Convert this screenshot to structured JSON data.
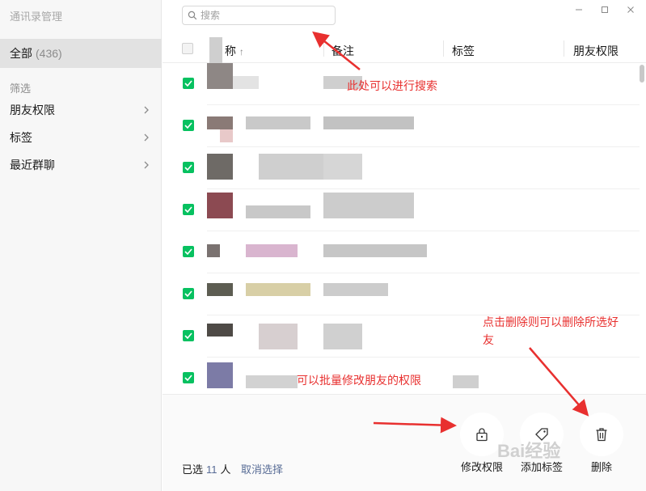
{
  "app": {
    "title": "通讯录管理"
  },
  "sidebar": {
    "all_label": "全部",
    "all_count": "(436)",
    "filter_section": "筛选",
    "filters": [
      {
        "label": "朋友权限"
      },
      {
        "label": "标签"
      },
      {
        "label": "最近群聊"
      }
    ]
  },
  "search": {
    "placeholder": "搜索"
  },
  "table": {
    "columns": [
      "称",
      "备注",
      "标签",
      "朋友权限"
    ],
    "sort_indicator": "↑",
    "rows_checked": [
      true,
      true,
      true,
      true,
      true,
      true,
      true,
      true
    ]
  },
  "footer": {
    "selected_prefix": "已选",
    "selected_count": "11",
    "selected_suffix": "人",
    "cancel_label": "取消选择",
    "actions": [
      {
        "label": "修改权限",
        "icon": "lock-icon"
      },
      {
        "label": "添加标签",
        "icon": "tag-icon"
      },
      {
        "label": "删除",
        "icon": "trash-icon"
      }
    ]
  },
  "annotations": {
    "search_note": "此处可以进行搜索",
    "batch_note": "可以批量修改朋友的权限",
    "delete_note_line1": "点击删除则可以删除所选好",
    "delete_note_line2": "友"
  },
  "watermark": {
    "text": "Bai经验"
  },
  "colors": {
    "accent_green": "#07c160",
    "link_blue": "#576b95",
    "annotation_red": "#e8302f"
  }
}
